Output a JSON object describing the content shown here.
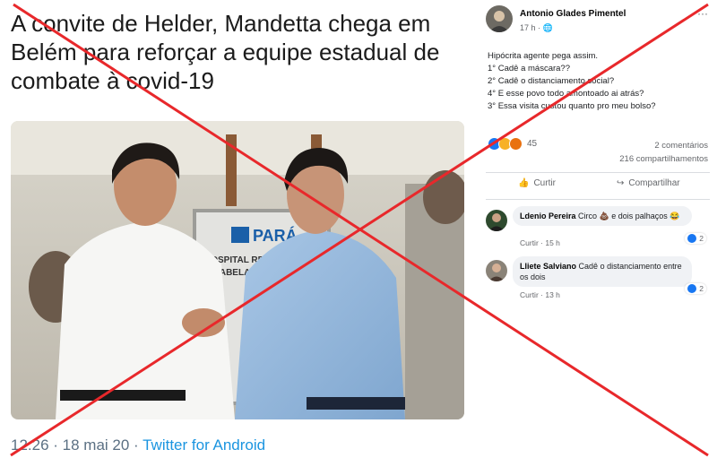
{
  "tweet": {
    "headline": [
      "A convite de Helder, Mandetta chega em",
      "Belém para reforçar a equipe estadual de",
      "combate à covid-19"
    ],
    "timestamp": "12:26 · 18 mai 20 · ",
    "source": "Twitter for Android",
    "photo_sign": [
      "HOSPITAL REG",
      "DR ABELARDO",
      "PARÁ"
    ]
  },
  "facebook": {
    "author": "Antonio Glades Pimentel",
    "time": "17 h",
    "more": "···",
    "post_lines": [
      "Hipócrita agente pega assim.",
      "1° Cadê a máscara??",
      "2° Cadê o distanciamento social?",
      "4° E esse povo todo amontoado ai atrás?",
      "3° Essa visita custou quanto pro meu bolso?"
    ],
    "reaction_count": "45",
    "comments_count": "2 comentários",
    "shares_count": "216 compartilhamentos",
    "actions": {
      "like": "Curtir",
      "share": "Compartilhar"
    },
    "comments": [
      {
        "author": "Ldenio Pereira",
        "text": "Circo 💩 e dois palhaços 😂",
        "like": "Curtir",
        "time": "15 h",
        "reactions": "2"
      },
      {
        "author": "Lliete Salviano",
        "text": "Cadê o distanciamento entre os dois",
        "like": "Curtir",
        "time": "13 h",
        "reactions": "2"
      }
    ]
  },
  "colors": {
    "cross": "#e8282b",
    "twitter_blue": "#1b95e0",
    "fb_like": "#1877f2"
  }
}
